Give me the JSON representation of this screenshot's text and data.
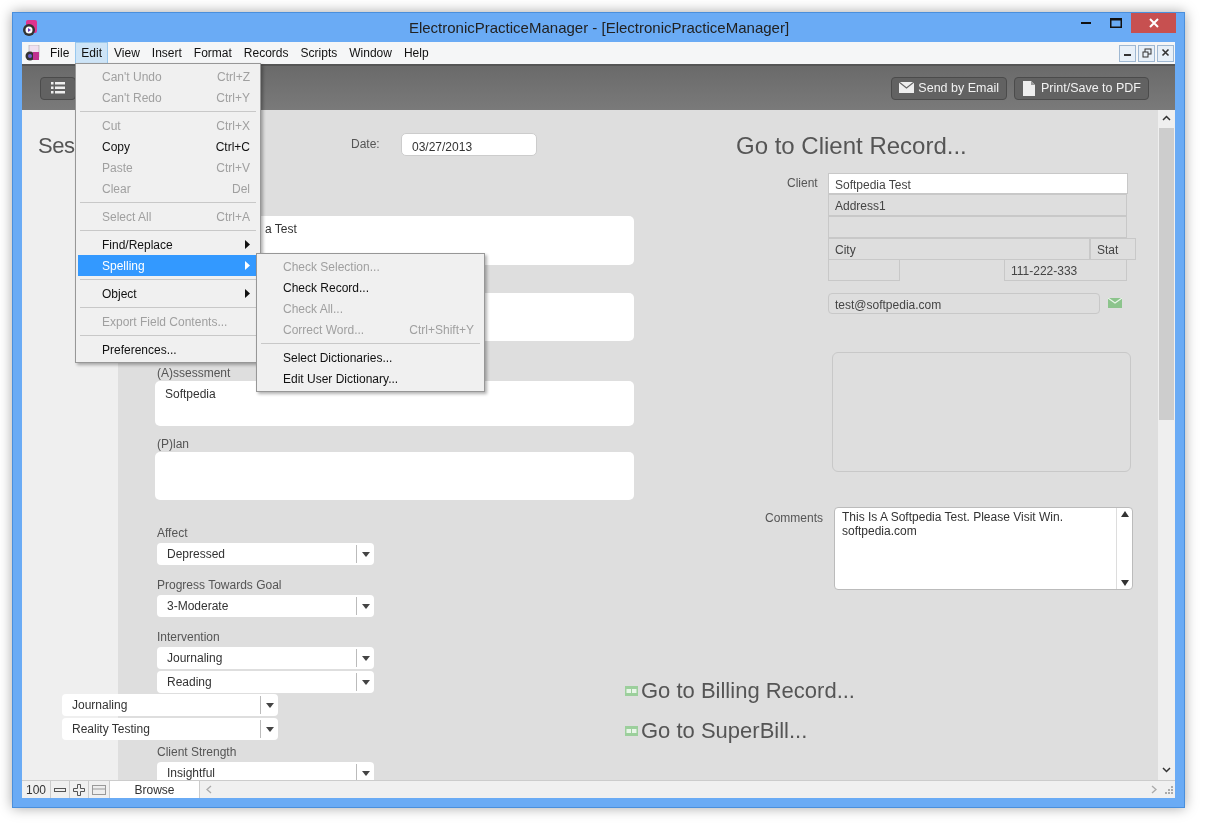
{
  "window": {
    "title": "ElectronicPracticeManager - [ElectronicPracticeManager]"
  },
  "menu_bar": [
    {
      "label": "File",
      "selected": false
    },
    {
      "label": "Edit",
      "selected": true
    },
    {
      "label": "View",
      "selected": false
    },
    {
      "label": "Insert",
      "selected": false
    },
    {
      "label": "Format",
      "selected": false
    },
    {
      "label": "Records",
      "selected": false
    },
    {
      "label": "Scripts",
      "selected": false
    },
    {
      "label": "Window",
      "selected": false
    },
    {
      "label": "Help",
      "selected": false
    }
  ],
  "edit_menu": [
    {
      "kind": "item",
      "label": "Can't Undo",
      "shortcut": "Ctrl+Z",
      "disabled": true
    },
    {
      "kind": "item",
      "label": "Can't Redo",
      "shortcut": "Ctrl+Y",
      "disabled": true
    },
    {
      "kind": "separator"
    },
    {
      "kind": "item",
      "label": "Cut",
      "shortcut": "Ctrl+X",
      "disabled": true
    },
    {
      "kind": "item",
      "label": "Copy",
      "shortcut": "Ctrl+C",
      "disabled": false
    },
    {
      "kind": "item",
      "label": "Paste",
      "shortcut": "Ctrl+V",
      "disabled": true
    },
    {
      "kind": "item",
      "label": "Clear",
      "shortcut": "Del",
      "disabled": true
    },
    {
      "kind": "separator"
    },
    {
      "kind": "item",
      "label": "Select All",
      "shortcut": "Ctrl+A",
      "disabled": true
    },
    {
      "kind": "separator"
    },
    {
      "kind": "submenu",
      "label": "Find/Replace",
      "selected": false
    },
    {
      "kind": "submenu",
      "label": "Spelling",
      "selected": true
    },
    {
      "kind": "separator"
    },
    {
      "kind": "submenu",
      "label": "Object",
      "selected": false
    },
    {
      "kind": "separator"
    },
    {
      "kind": "item",
      "label": "Export Field Contents...",
      "disabled": true
    },
    {
      "kind": "separator"
    },
    {
      "kind": "item",
      "label": "Preferences...",
      "disabled": false
    }
  ],
  "spelling_menu": [
    {
      "kind": "item",
      "label": "Check Selection...",
      "disabled": true
    },
    {
      "kind": "item",
      "label": "Check Record...",
      "disabled": false
    },
    {
      "kind": "item",
      "label": "Check All...",
      "disabled": true
    },
    {
      "kind": "item",
      "label": "Correct Word...",
      "shortcut": "Ctrl+Shift+Y",
      "disabled": true
    },
    {
      "kind": "separator"
    },
    {
      "kind": "item",
      "label": "Select Dictionaries...",
      "disabled": false
    },
    {
      "kind": "item",
      "label": "Edit User Dictionary...",
      "disabled": false
    }
  ],
  "toolbar": {
    "buttons": [
      "Send by Email",
      "Print/Save to PDF"
    ]
  },
  "session": {
    "heading": "Ses",
    "date_label": "Date:",
    "date": "03/27/2013",
    "notes": [
      {
        "value": "a Test"
      },
      {
        "label": "(A)ssessment",
        "value": "Softpedia"
      },
      {
        "label": "(P)lan"
      }
    ],
    "dropdowns": [
      {
        "label": "Affect",
        "values": [
          "Depressed"
        ]
      },
      {
        "label": "Progress Towards Goal",
        "values": [
          "3-Moderate"
        ]
      },
      {
        "label": "Intervention",
        "values": [
          "Journaling",
          "Reading"
        ]
      },
      {
        "values": [
          "Journaling",
          "Reality Testing"
        ]
      },
      {
        "label": "Client Strength",
        "values": [
          "Insightful"
        ]
      }
    ]
  },
  "client": {
    "heading": "Go to Client Record...",
    "label": "Client",
    "name": "Softpedia Test",
    "address1": "Address1",
    "city": "City",
    "state": "Stat",
    "phone": "111-222-333",
    "email": "test@softpedia.com"
  },
  "comments": {
    "label": "Comments",
    "value": "This Is A Softpedia Test. Please Visit Win. softpedia.com"
  },
  "links": [
    "Go to Billing Record...",
    "Go to SuperBill..."
  ],
  "status_bar": {
    "zoom": "100",
    "mode": "Browse"
  }
}
